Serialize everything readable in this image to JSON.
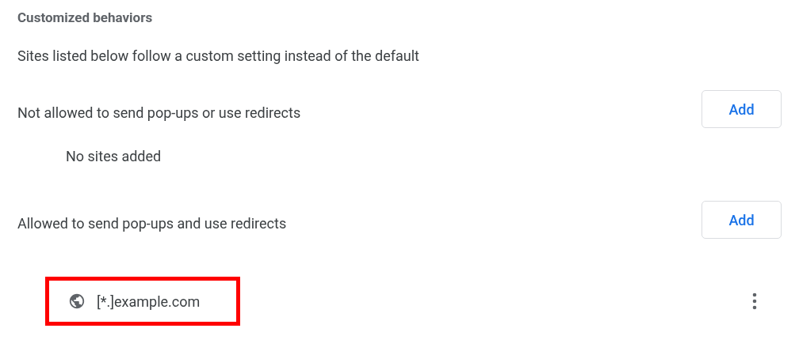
{
  "heading": "Customized behaviors",
  "description": "Sites listed below follow a custom setting instead of the default",
  "sections": [
    {
      "label": "Not allowed to send pop-ups or use redirects",
      "button": "Add",
      "empty_text": "No sites added"
    },
    {
      "label": "Allowed to send pop-ups and use redirects",
      "button": "Add",
      "sites": [
        {
          "site": "[*.]example.com",
          "highlighted": true
        }
      ]
    }
  ]
}
